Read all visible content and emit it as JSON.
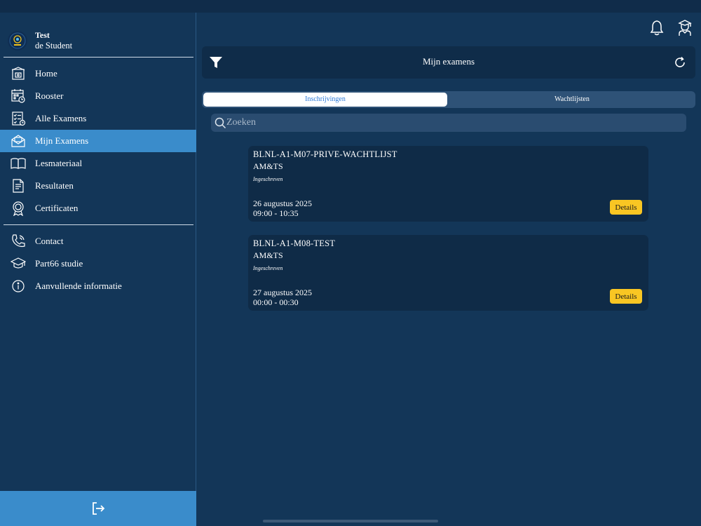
{
  "profile": {
    "name": "Test",
    "subtitle": "de  Student"
  },
  "nav": [
    {
      "label": "Home",
      "icon": "home-icon"
    },
    {
      "label": "Rooster",
      "icon": "calendar-clock-icon"
    },
    {
      "label": "Alle Examens",
      "icon": "checklist-icon"
    },
    {
      "label": "Mijn Examens",
      "icon": "envelope-icon",
      "active": true
    },
    {
      "label": "Lesmateriaal",
      "icon": "book-icon"
    },
    {
      "label": "Resultaten",
      "icon": "document-icon"
    },
    {
      "label": "Certificaten",
      "icon": "badge-icon"
    }
  ],
  "nav2": [
    {
      "label": "Contact",
      "icon": "phone-icon"
    },
    {
      "label": "Part66 studie",
      "icon": "graduation-cap-icon"
    },
    {
      "label": "Aanvullende informatie",
      "icon": "info-icon"
    }
  ],
  "header": {
    "title": "Mijn examens"
  },
  "tabs": {
    "active": "Inschrijvingen",
    "inactive": "Wachtlijsten"
  },
  "search": {
    "placeholder": "Zoeken"
  },
  "exams": [
    {
      "code": "BLNL-A1-M07-PRIVE-WACHTLIJST",
      "org": "AM&TS",
      "status": "Ingeschreven",
      "date": "26 augustus 2025",
      "time": "09:00 - 10:35",
      "button": "Details"
    },
    {
      "code": "BLNL-A1-M08-TEST",
      "org": "AM&TS",
      "status": "Ingeschreven",
      "date": "27 augustus 2025",
      "time": "00:00 - 00:30",
      "button": "Details"
    }
  ],
  "colors": {
    "background": "#133658",
    "active": "#3a8ccb",
    "card": "#0f2b47",
    "button": "#f9c623"
  }
}
